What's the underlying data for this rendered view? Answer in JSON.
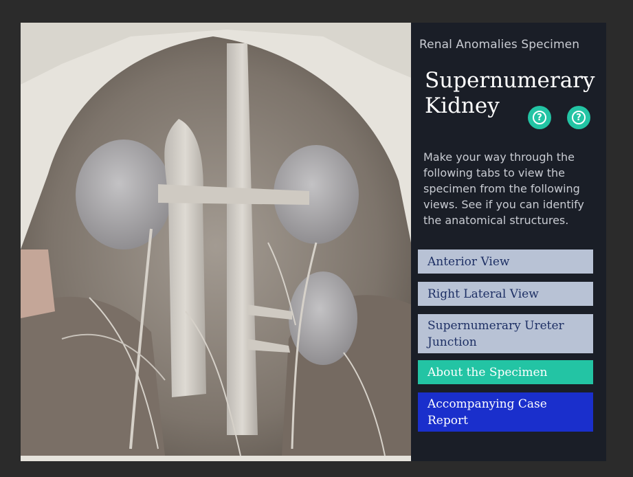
{
  "panel": {
    "subtitle": "Renal Anomalies Specimen",
    "title": "Supernumerary Kidney",
    "help_glyph": "?",
    "intro": "Make your way through the following tabs to view the specimen from the following views. See if you can identify the anatomical structures."
  },
  "tabs": [
    {
      "label": "Anterior View",
      "style": "grey"
    },
    {
      "label": "Right Lateral View",
      "style": "grey"
    },
    {
      "label": "Supernumerary Ureter Junction",
      "style": "grey"
    },
    {
      "label": "About the Specimen",
      "style": "teal"
    },
    {
      "label": "Accompanying Case Report",
      "style": "blue"
    }
  ],
  "icons": {
    "help": "question-circle-icon"
  },
  "colors": {
    "teal": "#23c4a4",
    "blue": "#1a2fcc",
    "grey_tab": "#b8c2d5",
    "panel_bg": "#1a1e27"
  }
}
